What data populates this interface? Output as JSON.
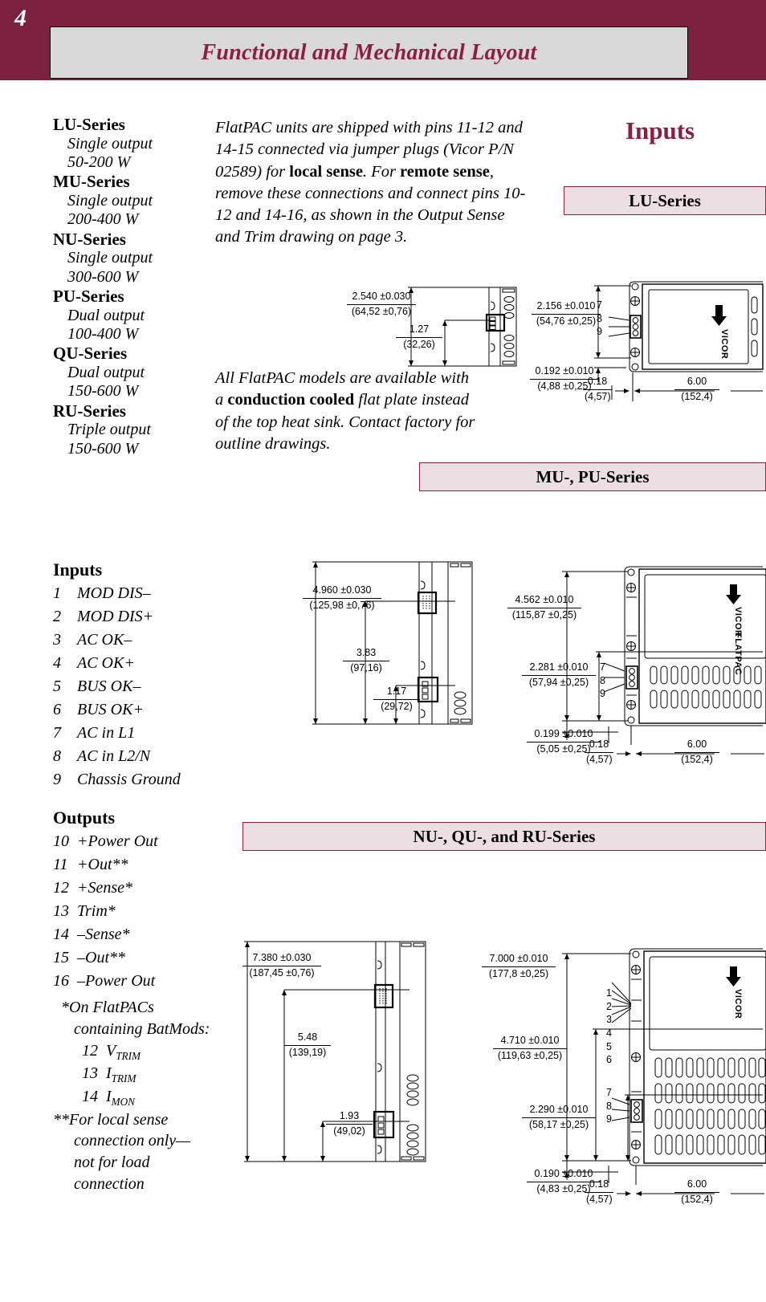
{
  "header": {
    "page_number": "4",
    "title": "Functional and Mechanical Layout"
  },
  "right_headline": "Inputs",
  "series_list": [
    {
      "name": "LU-Series",
      "desc_line1": "Single output",
      "desc_line2": "50-200 W"
    },
    {
      "name": "MU-Series",
      "desc_line1": "Single output",
      "desc_line2": "200-400 W"
    },
    {
      "name": "NU-Series",
      "desc_line1": "Single output",
      "desc_line2": "300-600 W"
    },
    {
      "name": "PU-Series",
      "desc_line1": "Dual output",
      "desc_line2": "100-400 W"
    },
    {
      "name": "QU-Series",
      "desc_line1": "Dual output",
      "desc_line2": "150-600 W"
    },
    {
      "name": "RU-Series",
      "desc_line1": "Triple output",
      "desc_line2": "150-600 W"
    }
  ],
  "inputs_section": {
    "heading": "Inputs",
    "pins": [
      {
        "num": "1",
        "label": "MOD DIS–"
      },
      {
        "num": "2",
        "label": "MOD DIS+"
      },
      {
        "num": "3",
        "label": "AC OK–"
      },
      {
        "num": "4",
        "label": "AC OK+"
      },
      {
        "num": "5",
        "label": "BUS OK–"
      },
      {
        "num": "6",
        "label": "BUS OK+"
      },
      {
        "num": "7",
        "label": "AC in L1"
      },
      {
        "num": "8",
        "label": "AC in L2/N"
      },
      {
        "num": "9",
        "label": "Chassis Ground"
      }
    ]
  },
  "outputs_section": {
    "heading": "Outputs",
    "pins": [
      {
        "num": "10",
        "label": "+Power Out"
      },
      {
        "num": "11",
        "label": "+Out**"
      },
      {
        "num": "12",
        "label": "+Sense*"
      },
      {
        "num": "13",
        "label": "Trim*"
      },
      {
        "num": "14",
        "label": "–Sense*"
      },
      {
        "num": "15",
        "label": "–Out**"
      },
      {
        "num": "16",
        "label": "–Power Out"
      }
    ],
    "footnotes": {
      "star_line1": "*On FlatPACs",
      "star_line2": "containing BatMods:",
      "star_pin12_num": "12",
      "star_pin12_sym": "V",
      "star_pin12_sub": "TRIM",
      "star_pin13_num": "13",
      "star_pin13_sym": "I",
      "star_pin13_sub": "TRIM",
      "star_pin14_num": "14",
      "star_pin14_sym": "I",
      "star_pin14_sub": "MON",
      "dstar_line1": "**For local sense",
      "dstar_line2": "connection only—",
      "dstar_line3": "not for load",
      "dstar_line4": "connection"
    }
  },
  "prose": {
    "jumper": {
      "p1": "FlatPAC units are shipped with pins 11-12 and 14-15 connected via jumper plugs (Vicor P/N 02589) for ",
      "b1": "local sense",
      "p2": ". For ",
      "b2": "remote sense",
      "p3": ", remove these connections and connect pins 10-12 and 14-16, as shown in the Output Sense and Trim drawing on page 3."
    },
    "cooled": {
      "p1": "All FlatPAC models are available with a ",
      "b1": "conduction cooled",
      "p2": " flat plate instead of the top heat sink. Contact factory for outline drawings."
    }
  },
  "banners": {
    "lu": "LU-Series",
    "mu": "MU-, PU-Series",
    "nu": "NU-, QU-, and RU-Series"
  },
  "drawings": {
    "lu_side": {
      "dim_overall_in": "2.540 ±0.030",
      "dim_overall_mm": "(64,52 ±0,76)",
      "dim_conn_in": "1.27",
      "dim_conn_mm": "(32,26)"
    },
    "lu_top": {
      "dim_height_in": "2.156 ±0.010",
      "dim_height_mm": "(54,76 ±0,25)",
      "dim_offset_in": "0.192 ±0.010",
      "dim_offset_mm": "(4,88 ±0,25)",
      "dim_edge_in": "0.18",
      "dim_edge_mm": "(4,57)",
      "dim_len_in": "6.00",
      "dim_len_mm": "(152,4)",
      "pins": [
        "7",
        "8",
        "9"
      ],
      "brand": "VICOR"
    },
    "mu_side": {
      "dim_overall_in": "4.960 ±0.030",
      "dim_overall_mm": "(125,98 ±0,76)",
      "dim_mid_in": "3.83",
      "dim_mid_mm": "(97,16)",
      "dim_low_in": "1.17",
      "dim_low_mm": "(29,72)"
    },
    "mu_top": {
      "dim_height_in": "4.562 ±0.010",
      "dim_height_mm": "(115,87 ±0,25)",
      "dim_mid_in": "2.281 ±0.010",
      "dim_mid_mm": "(57,94 ±0,25)",
      "dim_offset_in": "0.199 ±0.010",
      "dim_offset_mm": "(5,05 ±0,25)",
      "dim_edge_in": "0.18",
      "dim_edge_mm": "(4,57)",
      "dim_len_in": "6.00",
      "dim_len_mm": "(152,4)",
      "pins": [
        "7",
        "8",
        "9"
      ],
      "brand": "VICOR",
      "product": "FLATPAC"
    },
    "nu_side": {
      "dim_overall_in": "7.380 ±0.030",
      "dim_overall_mm": "(187,45 ±0,76)",
      "dim_mid_in": "5.48",
      "dim_mid_mm": "(139,19)",
      "dim_low_in": "1.93",
      "dim_low_mm": "(49,02)"
    },
    "nu_top": {
      "dim_height_in": "7.000 ±0.010",
      "dim_height_mm": "(177,8 ±0,25)",
      "dim_mid_in": "4.710 ±0.010",
      "dim_mid_mm": "(119,63 ±0,25)",
      "dim_low_in": "2.290 ±0.010",
      "dim_low_mm": "(58,17 ±0,25)",
      "dim_offset_in": "0.190 ±0.010",
      "dim_offset_mm": "(4,83 ±0,25)",
      "dim_edge_in": "0.18",
      "dim_edge_mm": "(4,57)",
      "dim_len_in": "6.00",
      "dim_len_mm": "(152,4)",
      "pins_upper": [
        "1",
        "2",
        "3",
        "4",
        "5",
        "6"
      ],
      "pins_lower": [
        "7",
        "8",
        "9"
      ],
      "brand": "VICOR"
    }
  },
  "colors": {
    "brand_maroon": "#7a2140",
    "title_maroon": "#8c1f40",
    "banner_fill": "#ecdfe3",
    "title_fill": "#d9d9d9"
  }
}
